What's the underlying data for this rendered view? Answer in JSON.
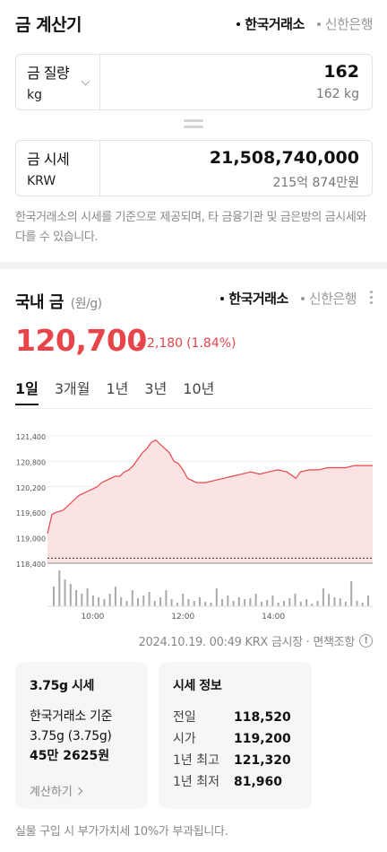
{
  "header": {
    "title": "금 계산기",
    "sources": [
      {
        "label": "한국거래소",
        "active": true
      },
      {
        "label": "신한은행",
        "active": false
      }
    ]
  },
  "converter": {
    "weight": {
      "label": "금 질량",
      "unit": "kg",
      "value": "162",
      "sub": "162 kg"
    },
    "price": {
      "label": "금 시세",
      "unit": "KRW",
      "value": "21,508,740,000",
      "sub": "215억 874만원"
    },
    "notice": "한국거래소의 시세를 기준으로 제공되며, 타 금융기관 및 금은방의 금시세와 다를 수 있습니다."
  },
  "domestic": {
    "title": "국내 금",
    "unit": "(원/g)",
    "sources": [
      {
        "label": "한국거래소",
        "active": true
      },
      {
        "label": "신한은행",
        "active": false
      }
    ],
    "price": "120,700",
    "change": "2,180",
    "change_pct": "(1.84%)",
    "periods": [
      {
        "label": "1일",
        "active": true
      },
      {
        "label": "3개월",
        "active": false
      },
      {
        "label": "1년",
        "active": false
      },
      {
        "label": "3년",
        "active": false
      },
      {
        "label": "10년",
        "active": false
      }
    ],
    "timestamp": "2024.10.19. 00:49 KRX 금시장 · 면책조항"
  },
  "chart_data": {
    "type": "area",
    "y_ticks": [
      "121,400",
      "120,800",
      "120,200",
      "119,600",
      "119,000",
      "118,400"
    ],
    "ylim": [
      118400,
      121400
    ],
    "x_ticks": [
      "10:00",
      "12:00",
      "14:00"
    ],
    "baseline": 118520,
    "series": [
      {
        "x_hours": [
          9.0,
          9.1,
          9.2,
          9.35,
          9.5,
          9.6,
          9.7,
          9.8,
          9.9,
          10.0,
          10.1,
          10.2,
          10.3,
          10.4,
          10.5,
          10.6,
          10.7,
          10.8,
          10.9,
          11.0,
          11.1,
          11.2,
          11.3,
          11.4,
          11.5,
          11.6,
          11.7,
          11.8,
          11.9,
          12.0,
          12.1,
          12.2,
          12.3,
          12.5,
          12.7,
          12.9,
          13.1,
          13.3,
          13.5,
          13.7,
          13.9,
          14.1,
          14.3,
          14.5,
          14.6,
          14.8,
          15.0,
          15.2,
          15.4,
          15.6,
          15.8,
          16.0,
          16.2
        ],
        "values": [
          119100,
          119550,
          119600,
          119650,
          119800,
          119900,
          120000,
          120050,
          120100,
          120150,
          120200,
          120300,
          120350,
          120400,
          120450,
          120450,
          120550,
          120600,
          120700,
          120850,
          121000,
          121100,
          121250,
          121300,
          121200,
          121100,
          121000,
          120800,
          120750,
          120600,
          120400,
          120350,
          120300,
          120300,
          120350,
          120400,
          120450,
          120500,
          120550,
          120500,
          120550,
          120600,
          120550,
          120400,
          120550,
          120600,
          120600,
          120650,
          120650,
          120650,
          120700,
          120700,
          120700
        ]
      }
    ],
    "volume": [
      22,
      40,
      30,
      25,
      18,
      14,
      20,
      12,
      10,
      8,
      14,
      22,
      10,
      6,
      18,
      9,
      12,
      16,
      6,
      10,
      18,
      8,
      4,
      14,
      8,
      6,
      10,
      5,
      4,
      20,
      8,
      12,
      6,
      10,
      8,
      9,
      14,
      5,
      7,
      12,
      4,
      6,
      9,
      14,
      5,
      8,
      3,
      6,
      20,
      14,
      10,
      9,
      5,
      28,
      6,
      4,
      12
    ]
  },
  "cards": {
    "price_card": {
      "title": "3.75g 시세",
      "line1": "한국거래소 기준",
      "line2": "3.75g (3.75g)",
      "line3": "45만 2625원",
      "link": "계산하기"
    },
    "info_card": {
      "title": "시세 정보",
      "rows": [
        {
          "k": "전일",
          "v": "118,520"
        },
        {
          "k": "시가",
          "v": "119,200"
        },
        {
          "k": "1년 최고",
          "v": "121,320"
        },
        {
          "k": "1년 최저",
          "v": "81,960"
        }
      ]
    }
  },
  "footer": "실물 구입 시 부가가치세 10%가 부과됩니다.",
  "colors": {
    "accent": "#e8454a",
    "fill": "#fbe3e3"
  }
}
